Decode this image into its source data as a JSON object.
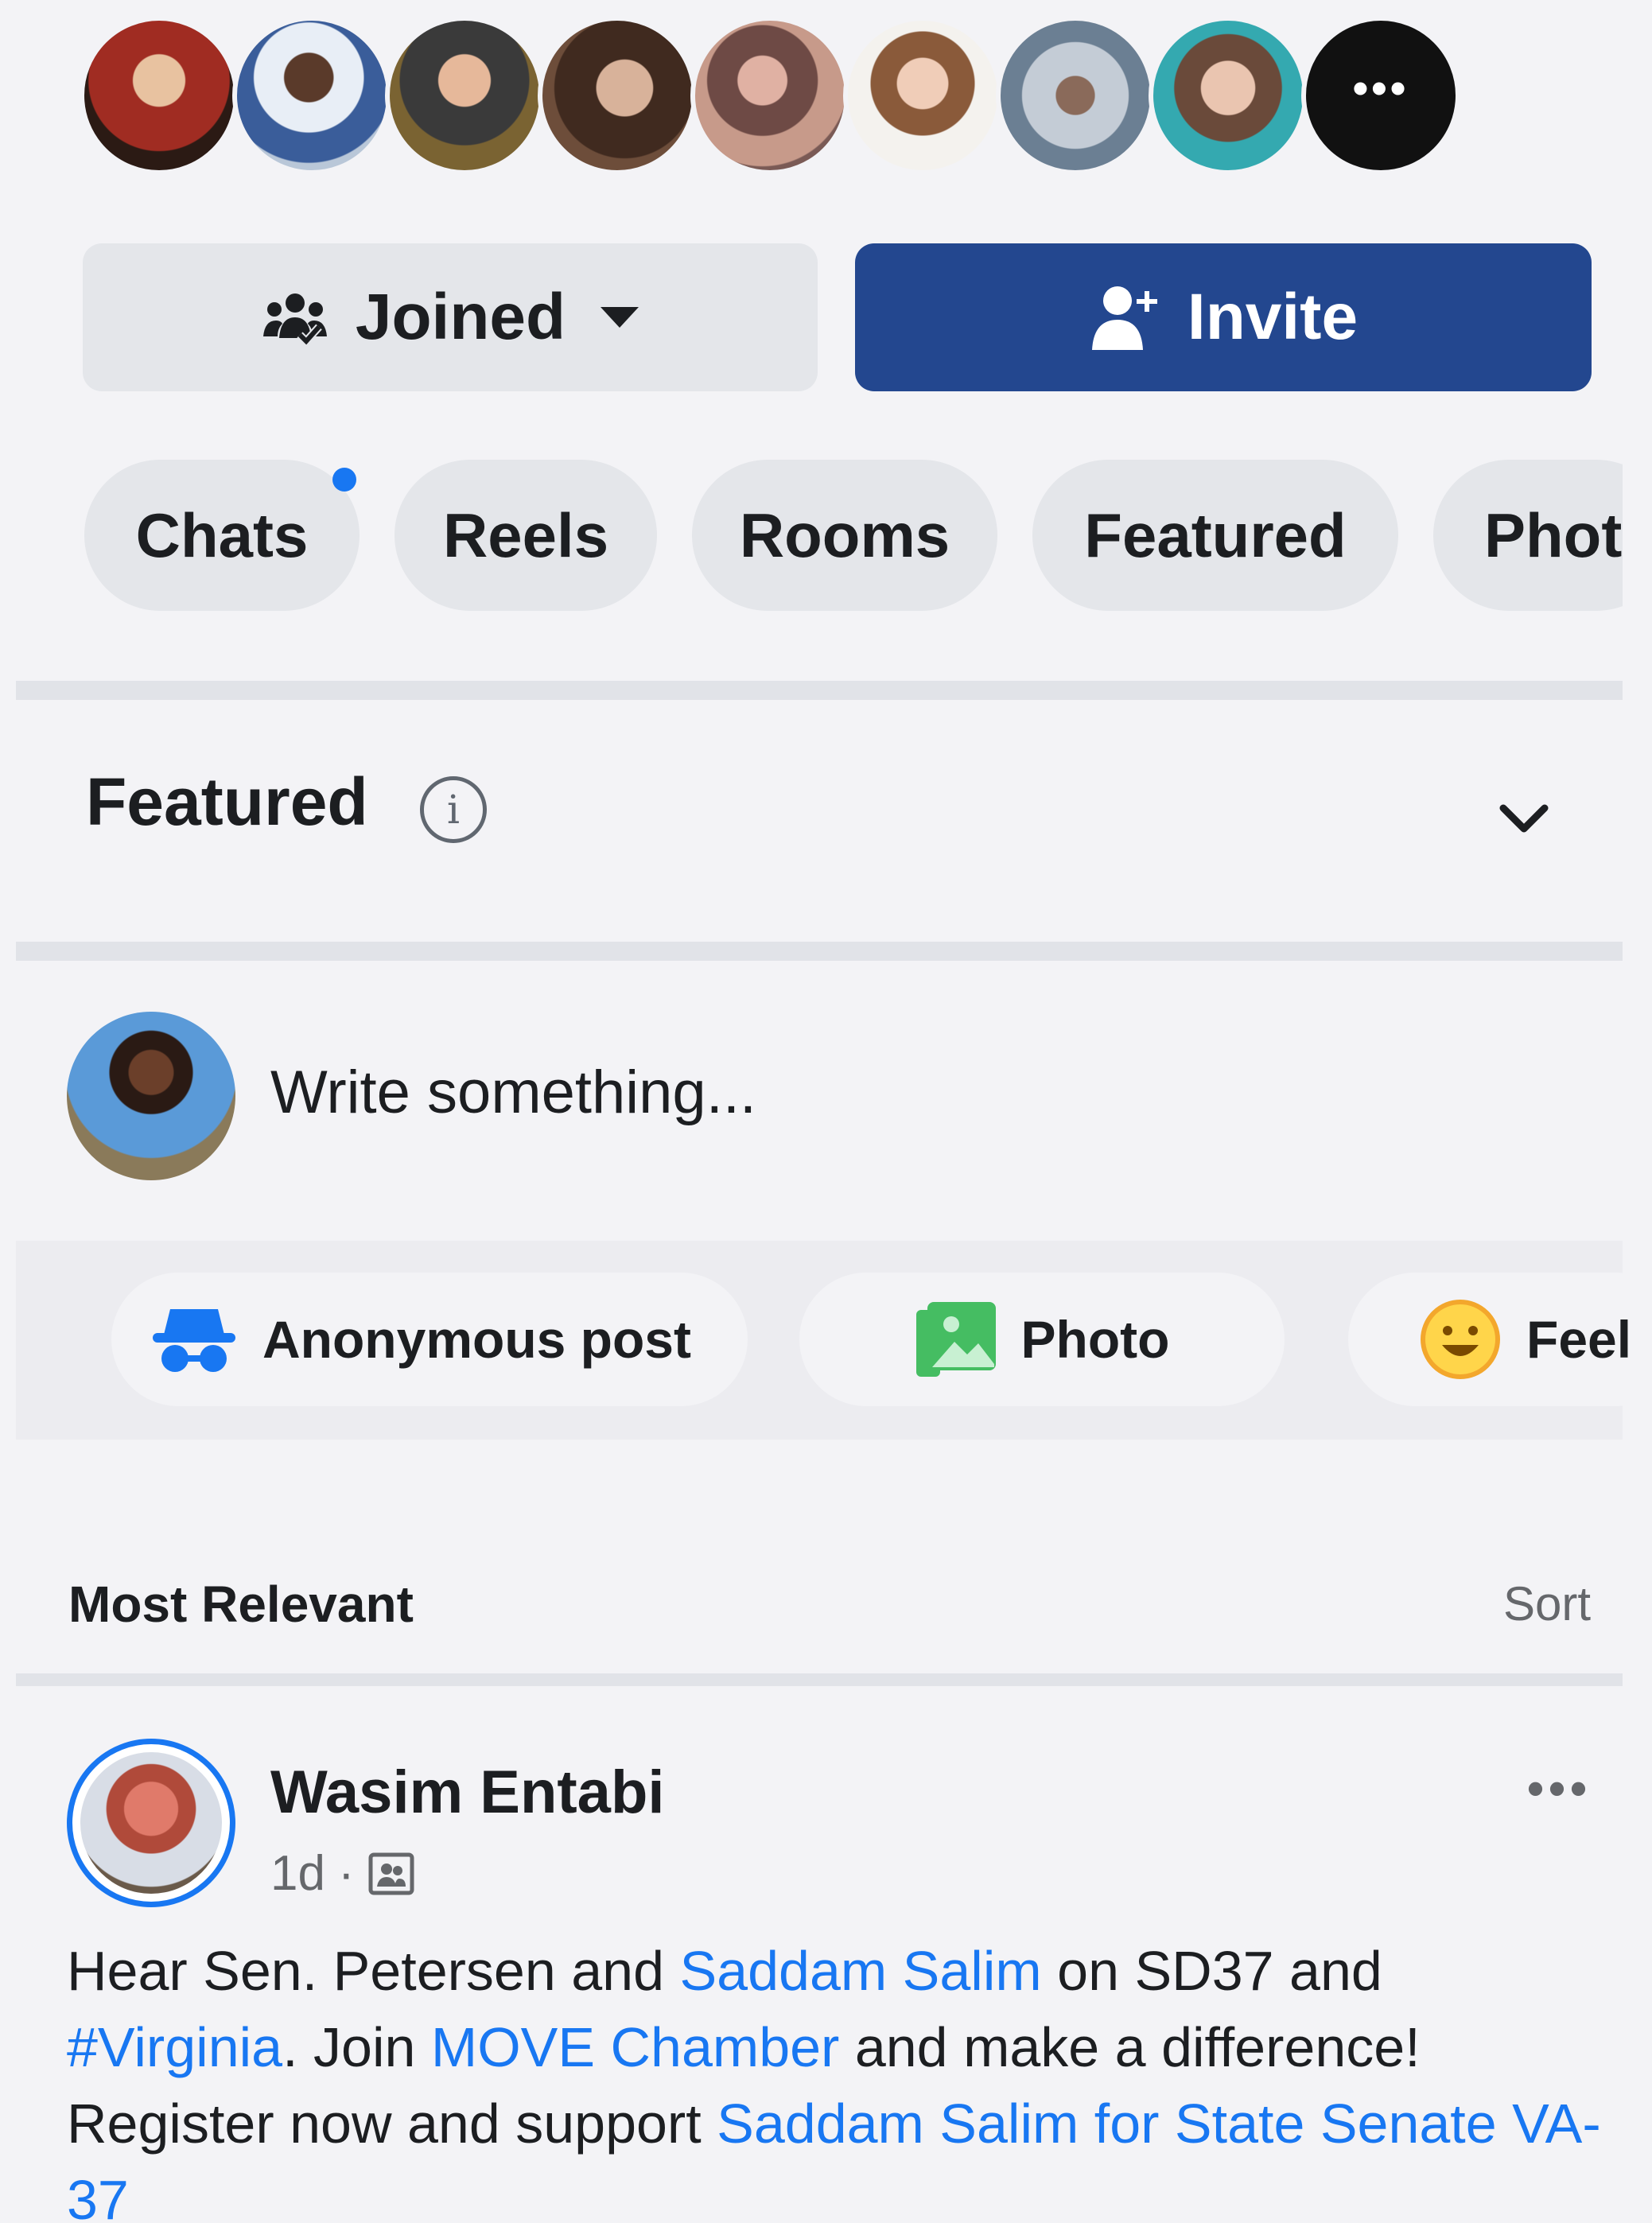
{
  "members": {
    "avatars": [
      {
        "name": "member-avatar-1",
        "color": "#8b2a1e"
      },
      {
        "name": "member-avatar-2",
        "color": "#4d6f9a"
      },
      {
        "name": "member-avatar-3",
        "color": "#8a6a3a"
      },
      {
        "name": "member-avatar-4",
        "color": "#5a3d2b"
      },
      {
        "name": "member-avatar-5",
        "color": "#b87b6c"
      },
      {
        "name": "member-avatar-6",
        "color": "#c9b8a4"
      },
      {
        "name": "member-avatar-7",
        "color": "#8fa0b0"
      },
      {
        "name": "member-avatar-8",
        "color": "#3bb3b6"
      }
    ],
    "more_icon": "more-horizontal-icon"
  },
  "actions": {
    "joined_label": "Joined",
    "joined_icon": "group-icon",
    "invite_label": "Invite",
    "invite_icon": "add-person-icon"
  },
  "tabs": [
    {
      "label": "Chats",
      "has_unread": true
    },
    {
      "label": "Reels"
    },
    {
      "label": "Rooms"
    },
    {
      "label": "Featured"
    },
    {
      "label": "Phot"
    }
  ],
  "featured": {
    "title": "Featured",
    "info_icon": "info-icon",
    "toggle_icon": "chevron-down-icon"
  },
  "composer": {
    "placeholder": "Write something...",
    "options": [
      {
        "label": "Anonymous post",
        "icon": "anonymous-icon"
      },
      {
        "label": "Photo",
        "icon": "photo-icon"
      },
      {
        "label": "Feel",
        "icon": "feeling-icon"
      }
    ]
  },
  "feed": {
    "sort_label": "Most Relevant",
    "sort_button": "Sort"
  },
  "post": {
    "author": "Wasim Entabi",
    "time": "1d",
    "separator": "·",
    "audience_icon": "group-audience-icon",
    "text": {
      "p1": "Hear Sen. Petersen and ",
      "link1": "Saddam Salim",
      "p2": " on SD37 and",
      "hashtag": "#Virginia",
      "p3": ". Join ",
      "link2": "MOVE Chamber",
      "p4": " and make a difference! Register now and support ",
      "link3": "Saddam Salim for State Senate VA-37"
    }
  },
  "colors": {
    "accent": "#1877f2",
    "invite_bg": "#23478f",
    "chip_bg": "#e4e6ea",
    "page_bg": "#f3f3f6"
  }
}
